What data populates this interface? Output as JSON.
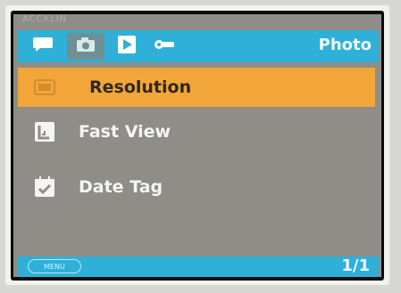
{
  "header": {
    "corner_text": "ACCKLIN",
    "mode_title": "Photo",
    "tabs": [
      {
        "name": "chat-icon"
      },
      {
        "name": "camera-icon",
        "active": true
      },
      {
        "name": "play-icon"
      },
      {
        "name": "wrench-icon"
      }
    ]
  },
  "menu": {
    "items": [
      {
        "label": "Resolution",
        "icon": "resolution-icon",
        "selected": true
      },
      {
        "label": "Fast View",
        "icon": "fast-view-icon",
        "selected": false
      },
      {
        "label": "Date Tag",
        "icon": "date-tag-icon",
        "selected": false
      }
    ]
  },
  "footer": {
    "menu_button_label": "MENU",
    "page_indicator": "1/1"
  },
  "colors": {
    "top_bar": "#2fb0d8",
    "selected_row": "#f2a63a",
    "screen_bg": "#8e8d88",
    "bottom_bar": "#2fb0d8"
  }
}
